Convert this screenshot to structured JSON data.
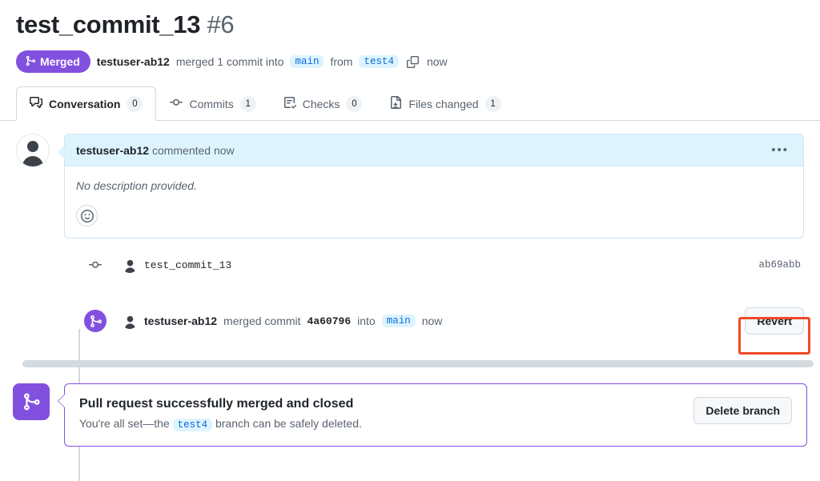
{
  "header": {
    "title": "test_commit_13",
    "number": "#6",
    "state_badge": {
      "label": "Merged",
      "icon": "git-merge-icon",
      "color": "#8250df"
    },
    "subhead": {
      "author": "testuser-ab12",
      "action_text": "merged 1 commit into",
      "base_branch": "main",
      "from_text": "from",
      "head_branch": "test4",
      "copy_icon": "copy-icon",
      "time": "now"
    }
  },
  "tabs": [
    {
      "label": "Conversation",
      "count": "0",
      "icon": "comment-discussion-icon",
      "active": true
    },
    {
      "label": "Commits",
      "count": "1",
      "icon": "commit-dot-icon",
      "active": false
    },
    {
      "label": "Checks",
      "count": "0",
      "icon": "checklist-icon",
      "active": false
    },
    {
      "label": "Files changed",
      "count": "1",
      "icon": "file-diff-icon",
      "active": false
    }
  ],
  "comment": {
    "avatar_icon": "user-avatar-icon",
    "author": "testuser-ab12",
    "meta": "commented now",
    "menu_icon": "kebab-menu-icon",
    "body": "No description provided.",
    "reaction_icon": "smiley-reaction-icon"
  },
  "timeline": {
    "commit_row": {
      "icon": "commit-dot-icon",
      "avatar_icon": "user-avatar-icon",
      "message": "test_commit_13",
      "sha": "ab69abb"
    },
    "merge_row": {
      "icon": "git-merge-icon",
      "avatar_icon": "user-avatar-icon",
      "author": "testuser-ab12",
      "action_text": "merged commit",
      "commit_sha": "4a60796",
      "into_text": "into",
      "branch": "main",
      "time": "now",
      "revert_label": "Revert",
      "revert_highlighted": true,
      "highlight_color": "#f04a28"
    }
  },
  "merged_banner": {
    "icon": "git-merge-icon",
    "title": "Pull request successfully merged and closed",
    "subtitle_before": "You're all set—the",
    "branch": "test4",
    "subtitle_after": "branch can be safely deleted.",
    "delete_button": "Delete branch",
    "accent_color": "#8250df"
  }
}
